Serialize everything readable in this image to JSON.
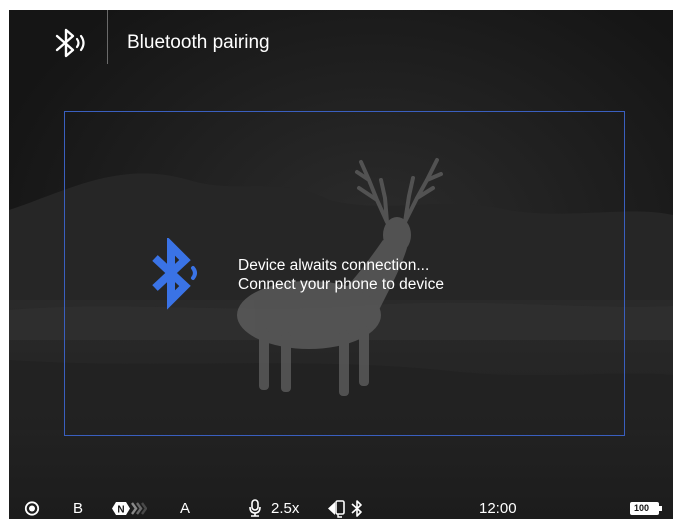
{
  "header": {
    "icon": "bluetooth-pairing-icon",
    "title": "Bluetooth pairing"
  },
  "dialog": {
    "icon": "bluetooth-icon",
    "line1": "Device alwaits connection...",
    "line2": "Connect your phone to device",
    "accent_color": "#3a73e6"
  },
  "status_bar": {
    "record_icon": "record-icon",
    "mode": "B",
    "noise_icon": "noise-reduction-icon",
    "calibration_mode": "A",
    "mic_icon": "microphone-icon",
    "zoom": "2.5x",
    "wifi_icon": "wifi-connected-icon",
    "bluetooth_icon": "bluetooth-icon",
    "time": "12:00",
    "battery": "100"
  }
}
